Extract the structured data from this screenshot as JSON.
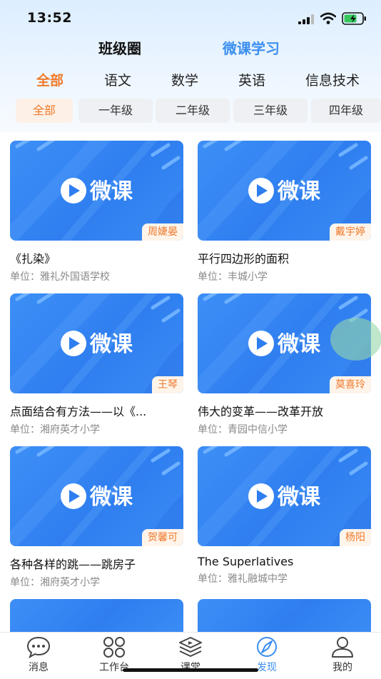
{
  "status_bar": {
    "time": "13:52"
  },
  "top_tabs": [
    {
      "label": "班级圈"
    },
    {
      "label": "微课学习"
    }
  ],
  "subjects": [
    "全部",
    "语文",
    "数学",
    "英语",
    "信息技术"
  ],
  "grades": [
    "全部",
    "一年级",
    "二年级",
    "三年级",
    "四年级"
  ],
  "logo_text": "微课",
  "cards": [
    {
      "title": "《扎染》",
      "org": "单位：雅礼外国语学校",
      "teacher": "周婕晏"
    },
    {
      "title": "平行四边形的面积",
      "org": "单位：丰城小学",
      "teacher": "戴宇婷"
    },
    {
      "title": "点面结合有方法——以《...",
      "org": "单位：湘府英才小学",
      "teacher": "王琴"
    },
    {
      "title": "伟大的变革——改革开放",
      "org": "单位：青园中信小学",
      "teacher": "莫喜玲"
    },
    {
      "title": "各种各样的跳——跳房子",
      "org": "单位：湘府英才小学",
      "teacher": "贺馨可"
    },
    {
      "title": "The Superlatives",
      "org": "单位：雅礼融城中学",
      "teacher": "杨阳"
    }
  ],
  "tabbar": [
    {
      "label": "消息",
      "icon": "chat-bubble-icon"
    },
    {
      "label": "工作台",
      "icon": "grid-icon"
    },
    {
      "label": "课堂",
      "icon": "layers-icon"
    },
    {
      "label": "发现",
      "icon": "compass-icon"
    },
    {
      "label": "我的",
      "icon": "person-icon"
    }
  ],
  "colors": {
    "accent_blue": "#3b8ff0",
    "accent_orange": "#f07a2a",
    "card_blue": "#3d8ff6"
  }
}
